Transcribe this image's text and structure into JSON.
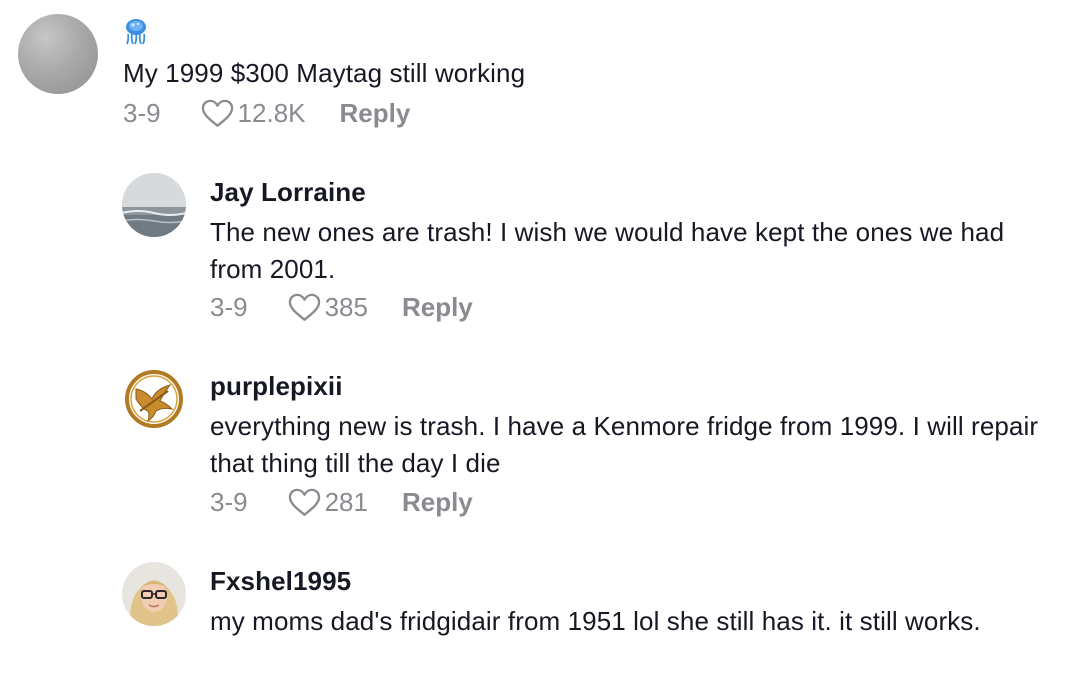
{
  "top_comment": {
    "username_icon": "jellyfish-emoji-icon",
    "text": "My 1999 $300 Maytag still working",
    "date": "3-9",
    "likes": "12.8K",
    "reply_label": "Reply"
  },
  "replies": [
    {
      "username": "Jay Lorraine",
      "avatar_icon": "seascape-avatar",
      "text": "The new ones are trash! I wish we would have kept the ones we had from 2001.",
      "date": "3-9",
      "likes": "385",
      "reply_label": "Reply"
    },
    {
      "username": "purplepixii",
      "avatar_icon": "mockingjay-pin-avatar",
      "text": "everything new is trash. I have a Kenmore fridge from 1999. I will repair that thing till the day I die",
      "date": "3-9",
      "likes": "281",
      "reply_label": "Reply"
    },
    {
      "username": "Fxshel1995",
      "avatar_icon": "woman-with-glasses-avatar",
      "text": "my moms dad's fridgidair from 1951 lol she still has it. it still works."
    }
  ],
  "colors": {
    "text": "#161823",
    "secondary": "#8a8b91"
  }
}
